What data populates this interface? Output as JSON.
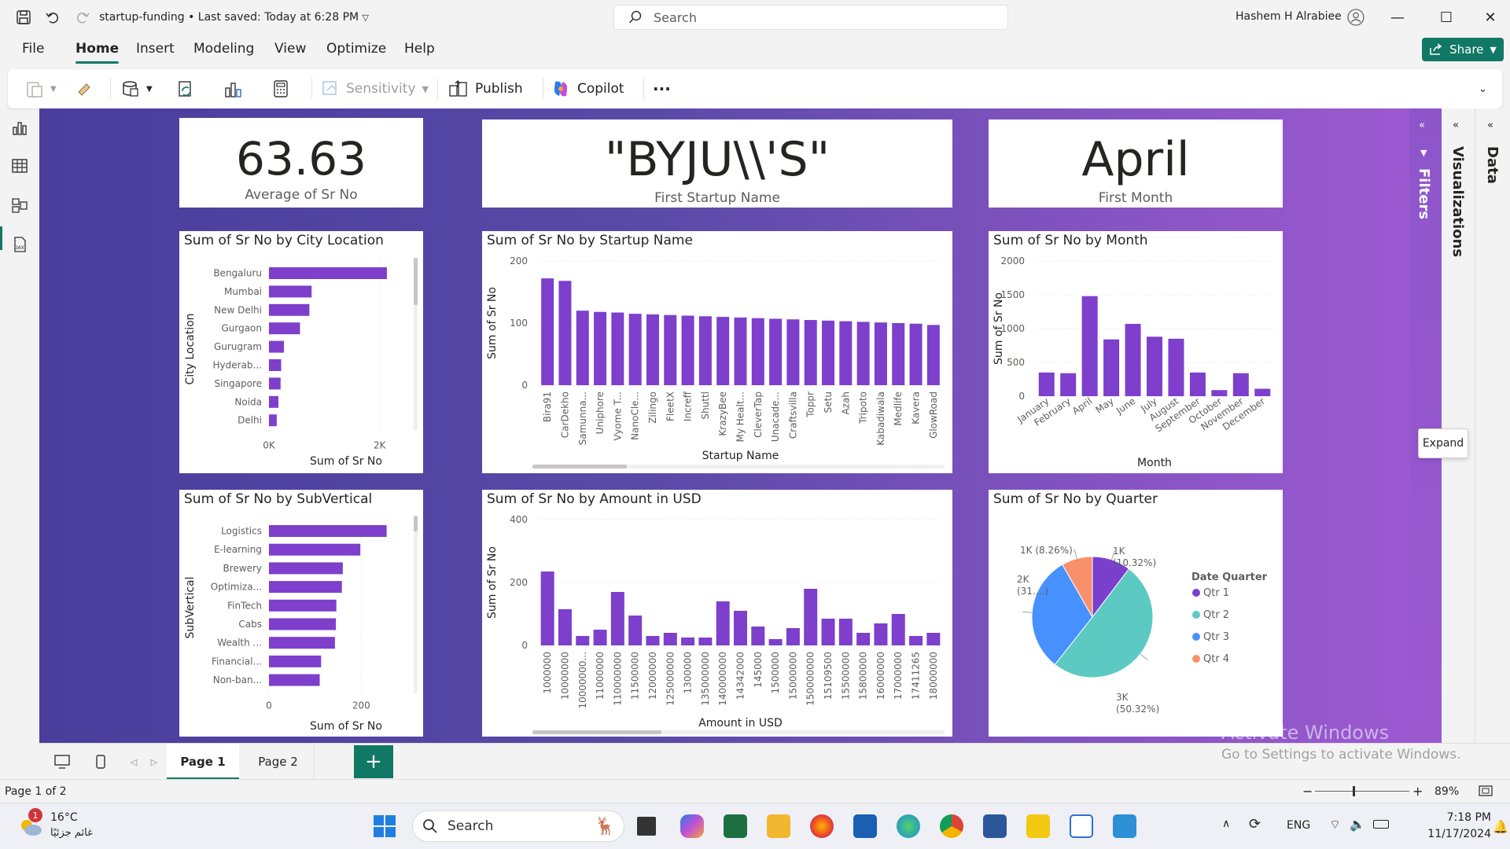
{
  "titlebar": {
    "doc_title": "startup-funding • Last saved: Today at 6:28 PM",
    "search_placeholder": "Search",
    "user_name": "Hashem H Alrabiee"
  },
  "menu": [
    "File",
    "Home",
    "Insert",
    "Modeling",
    "View",
    "Optimize",
    "Help"
  ],
  "share_label": "Share",
  "ribbon": {
    "sensitivity": "Sensitivity",
    "publish": "Publish",
    "copilot": "Copilot",
    "more": "···"
  },
  "kpis": [
    {
      "value": "63.63",
      "label": "Average of Sr No"
    },
    {
      "value": "\"BYJU\\\\'S\"",
      "label": "First Startup Name"
    },
    {
      "value": "April",
      "label": "First Month"
    }
  ],
  "chart_data": [
    {
      "type": "bar",
      "orientation": "horizontal",
      "title": "Sum of Sr No by City Location",
      "xlabel": "Sum of Sr No",
      "ylabel": "City Location",
      "categories": [
        "Bengaluru",
        "Mumbai",
        "New Delhi",
        "Gurgaon",
        "Gurugram",
        "Hyderab...",
        "Singapore",
        "Noida",
        "Delhi"
      ],
      "values": [
        2130,
        770,
        730,
        560,
        270,
        220,
        210,
        170,
        140
      ],
      "xlim": [
        0,
        2500
      ],
      "xticks": [
        "0K",
        "2K"
      ],
      "xtick_values": [
        0,
        2000
      ]
    },
    {
      "type": "bar",
      "title": "Sum of Sr No by Startup Name",
      "xlabel": "Startup Name",
      "ylabel": "Sum of Sr No",
      "categories": [
        "Bira91",
        "CarDekho",
        "Samunna...",
        "Uniphore",
        "Vyome T...",
        "NanoCle...",
        "Zilingo",
        "FleetX",
        "Increff",
        "Shuttl",
        "KrazyBee",
        "My Healt...",
        "CleverTap",
        "Unacade...",
        "Craftsvilla",
        "Toppr",
        "Setu",
        "Azah",
        "Tripoto",
        "Kabadiwala",
        "Medlife",
        "Kavera",
        "GlowRoad"
      ],
      "values": [
        172,
        168,
        120,
        118,
        117,
        115,
        114,
        113,
        112,
        111,
        110,
        109,
        108,
        107,
        106,
        105,
        104,
        103,
        102,
        101,
        100,
        99,
        97
      ],
      "ylim": [
        0,
        200
      ],
      "yticks": [
        0,
        100,
        200
      ]
    },
    {
      "type": "bar",
      "title": "Sum of Sr No by Month",
      "xlabel": "Month",
      "ylabel": "Sum of Sr No",
      "categories": [
        "January",
        "February",
        "April",
        "May",
        "June",
        "July",
        "August",
        "September",
        "October",
        "November",
        "December"
      ],
      "values": [
        350,
        340,
        1480,
        840,
        1070,
        880,
        850,
        350,
        90,
        340,
        110
      ],
      "ylim": [
        0,
        2000
      ],
      "yticks": [
        0,
        500,
        1000,
        1500,
        2000
      ]
    },
    {
      "type": "bar",
      "orientation": "horizontal",
      "title": "Sum of Sr No by SubVertical",
      "xlabel": "Sum of Sr No",
      "ylabel": "SubVertical",
      "categories": [
        "Logistics",
        "E-learning",
        "Brewery",
        "Optimiza...",
        "FinTech",
        "Cabs",
        "Wealth ...",
        "Financial...",
        "Non-ban..."
      ],
      "values": [
        255,
        198,
        160,
        158,
        146,
        145,
        143,
        113,
        110
      ],
      "xlim": [
        0,
        300
      ],
      "xticks": [
        0,
        200
      ]
    },
    {
      "type": "bar",
      "title": "Sum of Sr No by Amount in USD",
      "xlabel": "Amount in USD",
      "ylabel": "Sum of Sr No",
      "categories": [
        "1000000",
        "10000000",
        "10000000...",
        "11000000",
        "110000000",
        "11500000",
        "12000000",
        "125000000",
        "1300000",
        "135000000",
        "140000000",
        "14342000",
        "145000",
        "1500000",
        "15000000",
        "150000000",
        "15109500",
        "15500000",
        "15800000",
        "16000000",
        "17000000",
        "17411265",
        "18000000"
      ],
      "values": [
        235,
        115,
        30,
        50,
        170,
        95,
        30,
        40,
        25,
        25,
        140,
        110,
        60,
        20,
        55,
        180,
        85,
        85,
        40,
        70,
        100,
        30,
        40
      ],
      "ylim": [
        0,
        400
      ],
      "yticks": [
        0,
        200,
        400
      ]
    },
    {
      "type": "pie",
      "title": "Sum of Sr No by Quarter",
      "legend_title": "Date Quarter",
      "categories": [
        "Qtr 1",
        "Qtr 2",
        "Qtr 3",
        "Qtr 4"
      ],
      "values": [
        10.32,
        50.32,
        31.1,
        8.26
      ],
      "data_labels": [
        "1K\n(10.32%)",
        "3K\n(50.32%)",
        "2K\n(31....)",
        "1K (8.26%)"
      ],
      "colors": [
        "#7b3fce",
        "#5ccac3",
        "#4791ff",
        "#f7906b"
      ],
      "legend_position": "right"
    }
  ],
  "colors": {
    "bar": "#7d3fcc",
    "accent": "#117865"
  },
  "panes": {
    "filters": "Filters",
    "visualizations": "Visualizations",
    "data": "Data"
  },
  "tooltip_expand": "Expand",
  "pages": [
    "Page 1",
    "Page 2"
  ],
  "status": {
    "page": "Page 1 of 2",
    "zoom": "89%"
  },
  "watermark": {
    "line1": "Activate Windows",
    "line2": "Go to Settings to activate Windows."
  },
  "taskbar": {
    "weather_temp": "16°C",
    "weather_desc": "غائم جزئيًا",
    "weather_badge": "1",
    "search": "Search",
    "lang": "ENG",
    "time": "7:18 PM",
    "date": "11/17/2024"
  }
}
